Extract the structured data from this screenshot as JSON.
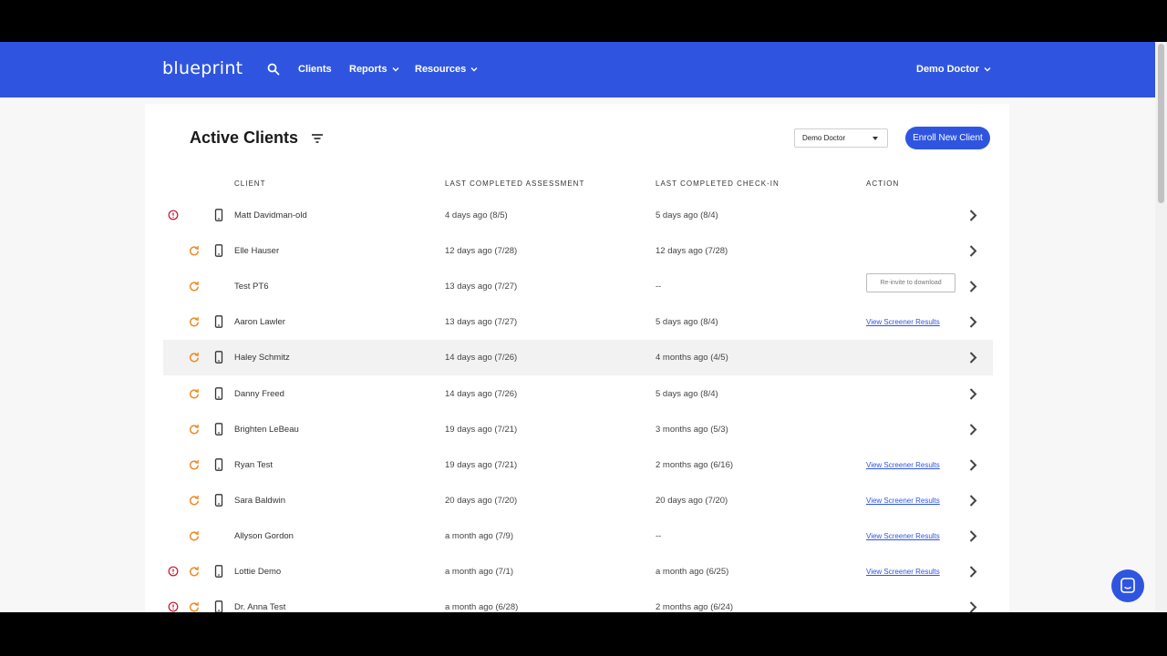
{
  "header": {
    "logo": "blueprint",
    "nav": [
      {
        "label": "Clients"
      },
      {
        "label": "Reports"
      },
      {
        "label": "Resources"
      }
    ],
    "user": "Demo Doctor",
    "icons": {
      "search": "search-icon",
      "chevron": "chevron-down-icon"
    }
  },
  "main": {
    "title": "Active Clients",
    "doctor_filter": "Demo Doctor",
    "enroll_label": "Enroll New Client",
    "columns": {
      "client": "CLIENT",
      "assessment": "LAST COMPLETED ASSESSMENT",
      "checkin": "LAST COMPLETED CHECK-IN",
      "action": "ACTION"
    },
    "rows": [
      {
        "name": "Matt Davidman-old",
        "assessment": "4 days ago (8/5)",
        "checkin": "5 days ago (8/4)",
        "alert": true,
        "refresh": false,
        "phone": true,
        "action": ""
      },
      {
        "name": "Elle Hauser",
        "assessment": "12 days ago (7/28)",
        "checkin": "12 days ago (7/28)",
        "alert": false,
        "refresh": true,
        "phone": true,
        "action": ""
      },
      {
        "name": "Test PT6",
        "assessment": "13 days ago (7/27)",
        "checkin": "--",
        "alert": false,
        "refresh": true,
        "phone": false,
        "action": "Re-invite to download"
      },
      {
        "name": "Aaron Lawler",
        "assessment": "13 days ago (7/27)",
        "checkin": "5 days ago (8/4)",
        "alert": false,
        "refresh": true,
        "phone": true,
        "action": "View Screener Results"
      },
      {
        "name": "Haley Schmitz",
        "assessment": "14 days ago (7/26)",
        "checkin": "4 months ago (4/5)",
        "alert": false,
        "refresh": true,
        "phone": true,
        "action": ""
      },
      {
        "name": "Danny Freed",
        "assessment": "14 days ago (7/26)",
        "checkin": "5 days ago (8/4)",
        "alert": false,
        "refresh": true,
        "phone": true,
        "action": ""
      },
      {
        "name": "Brighten LeBeau",
        "assessment": "19 days ago (7/21)",
        "checkin": "3 months ago (5/3)",
        "alert": false,
        "refresh": true,
        "phone": true,
        "action": ""
      },
      {
        "name": "Ryan Test",
        "assessment": "19 days ago (7/21)",
        "checkin": "2 months ago (6/16)",
        "alert": false,
        "refresh": true,
        "phone": true,
        "action": "View Screener Results"
      },
      {
        "name": "Sara Baldwin",
        "assessment": "20 days ago (7/20)",
        "checkin": "20 days ago (7/20)",
        "alert": false,
        "refresh": true,
        "phone": true,
        "action": "View Screener Results"
      },
      {
        "name": "Allyson Gordon",
        "assessment": "a month ago (7/9)",
        "checkin": "--",
        "alert": false,
        "refresh": true,
        "phone": false,
        "action": "View Screener Results"
      },
      {
        "name": "Lottie Demo",
        "assessment": "a month ago (7/1)",
        "checkin": "a month ago (6/25)",
        "alert": true,
        "refresh": true,
        "phone": true,
        "action": "View Screener Results"
      },
      {
        "name": "Dr. Anna Test",
        "assessment": "a month ago (6/28)",
        "checkin": "2 months ago (6/24)",
        "alert": true,
        "refresh": true,
        "phone": true,
        "action": ""
      }
    ]
  },
  "colors": {
    "brand": "#2f55e0",
    "alert": "#c8102e",
    "refresh": "#f08a24"
  }
}
